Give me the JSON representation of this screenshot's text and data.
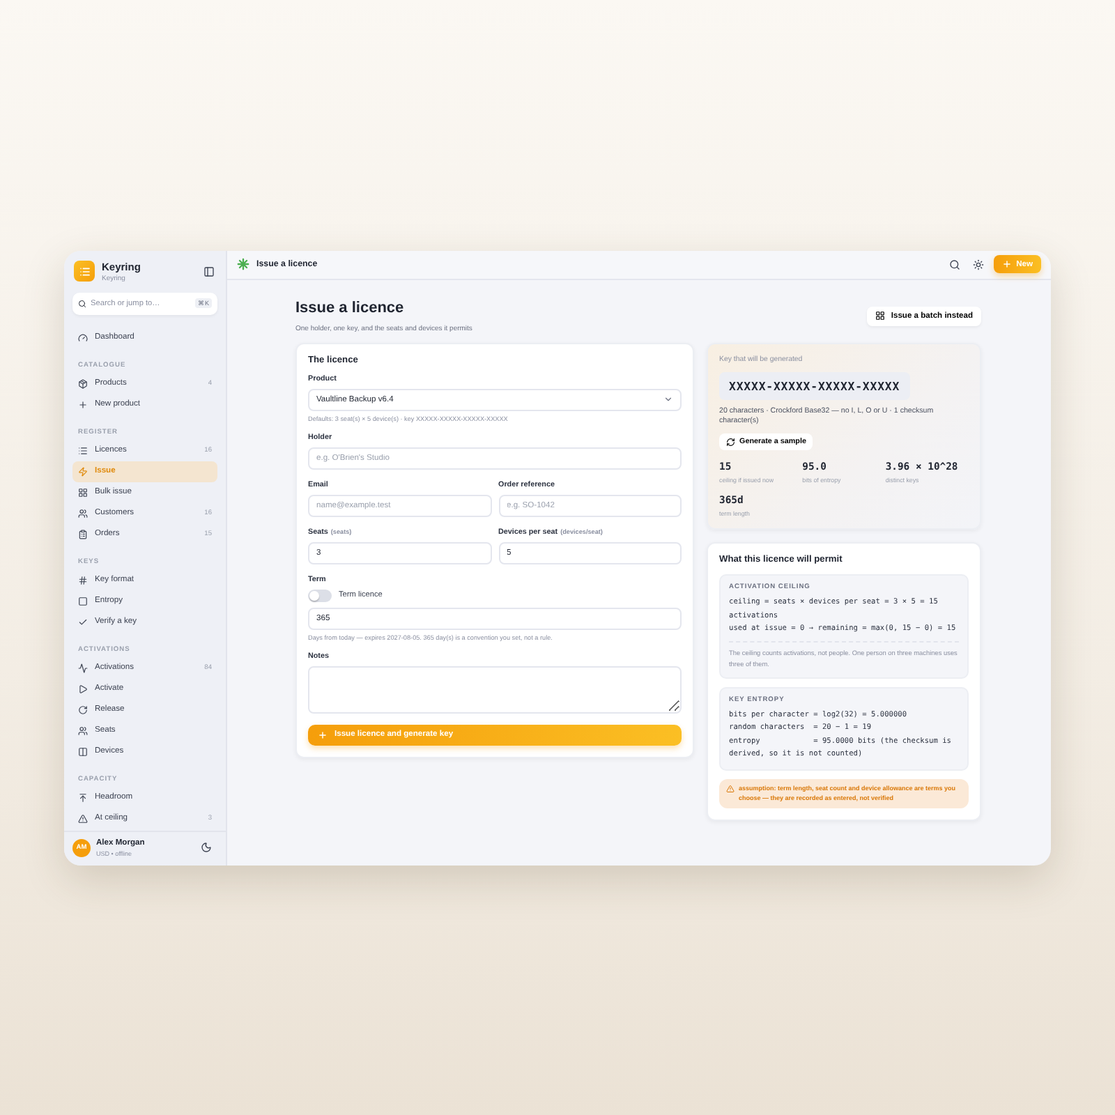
{
  "app": {
    "name": "Keyring",
    "subtitle": "Keyring"
  },
  "search": {
    "placeholder": "Search or jump to…",
    "shortcut": "⌘K"
  },
  "sidebar": {
    "dashboard": {
      "label": "Dashboard",
      "selected": false
    },
    "sections": [
      {
        "title": "CATALOGUE",
        "items": [
          {
            "label": "Products",
            "count": "4",
            "selected": false
          },
          {
            "label": "New product",
            "selected": false
          }
        ]
      },
      {
        "title": "REGISTER",
        "items": [
          {
            "label": "Licences",
            "count": "16",
            "selected": false
          },
          {
            "label": "Issue",
            "selected": true
          },
          {
            "label": "Bulk issue",
            "selected": false
          },
          {
            "label": "Customers",
            "count": "16",
            "selected": false
          },
          {
            "label": "Orders",
            "count": "15",
            "selected": false
          }
        ]
      },
      {
        "title": "KEYS",
        "items": [
          {
            "label": "Key format",
            "selected": false
          },
          {
            "label": "Entropy",
            "selected": false
          },
          {
            "label": "Verify a key",
            "selected": false
          }
        ]
      },
      {
        "title": "ACTIVATIONS",
        "items": [
          {
            "label": "Activations",
            "count": "84",
            "selected": false
          },
          {
            "label": "Activate",
            "selected": false
          },
          {
            "label": "Release",
            "selected": false
          },
          {
            "label": "Seats",
            "selected": false
          },
          {
            "label": "Devices",
            "selected": false
          }
        ]
      },
      {
        "title": "CAPACITY",
        "items": [
          {
            "label": "Headroom",
            "selected": false
          },
          {
            "label": "At ceiling",
            "count": "3",
            "selected": false
          }
        ]
      }
    ]
  },
  "user": {
    "initials": "AM",
    "name": "Alex Morgan",
    "status": "USD • offline"
  },
  "topbar": {
    "title": "Issue a licence",
    "new_button": "New"
  },
  "page": {
    "title": "Issue a licence",
    "subtitle": "One holder, one key, and the seats and devices it permits",
    "batch_button": "Issue a batch instead"
  },
  "form": {
    "title": "The licence",
    "product": {
      "label": "Product",
      "value": "Vaultline Backup v6.4",
      "hint": "Defaults: 3 seat(s) × 5 device(s) · key XXXXX-XXXXX-XXXXX-XXXXX"
    },
    "holder": {
      "label": "Holder",
      "placeholder": "e.g. O'Brien's Studio"
    },
    "email": {
      "label": "Email",
      "placeholder": "name@example.test"
    },
    "order": {
      "label": "Order reference",
      "placeholder": "e.g. SO-1042"
    },
    "seats": {
      "label": "Seats",
      "unit": "(seats)",
      "value": "3"
    },
    "devices": {
      "label": "Devices per seat",
      "unit": "(devices/seat)",
      "value": "5"
    },
    "term": {
      "label": "Term",
      "toggle": {
        "label": "Term licence",
        "on": false
      },
      "value": "365",
      "hint": "Days from today — expires 2027-08-05. 365 day(s) is a convention you set, not a rule."
    },
    "notes": {
      "label": "Notes"
    },
    "submit": "Issue licence and generate key"
  },
  "key_preview": {
    "label": "Key that will be generated",
    "key": "XXXXX-XXXXX-XXXXX-XXXXX",
    "description": "20 characters · Crockford Base32 — no I, L, O or U · 1 checksum character(s)",
    "sample_button": "Generate a sample",
    "stats": [
      {
        "value": "15",
        "label": "ceiling if issued now"
      },
      {
        "value": "95.0",
        "label": "bits of entropy"
      },
      {
        "value": "3.96 × 10^28",
        "label": "distinct keys"
      },
      {
        "value": "365d",
        "label": "term length"
      }
    ]
  },
  "permit": {
    "title": "What this licence will permit",
    "blocks": [
      {
        "heading": "ACTIVATION CEILING",
        "lines": [
          "ceiling = seats × devices per seat = 3 × 5 = 15 activations",
          "used at issue = 0 → remaining = max(0, 15 − 0) = 15"
        ],
        "note": "The ceiling counts activations, not people. One person on three machines uses three of them."
      },
      {
        "heading": "KEY ENTROPY",
        "lines": [
          "bits per character = log2(32) = 5.000000",
          "random characters  = 20 − 1 = 19",
          "entropy            = 95.0000 bits (the checksum is derived, so it is not counted)"
        ]
      }
    ],
    "warning": "assumption: term length, seat count and device allowance are terms you choose — they are recorded as entered, not verified"
  }
}
